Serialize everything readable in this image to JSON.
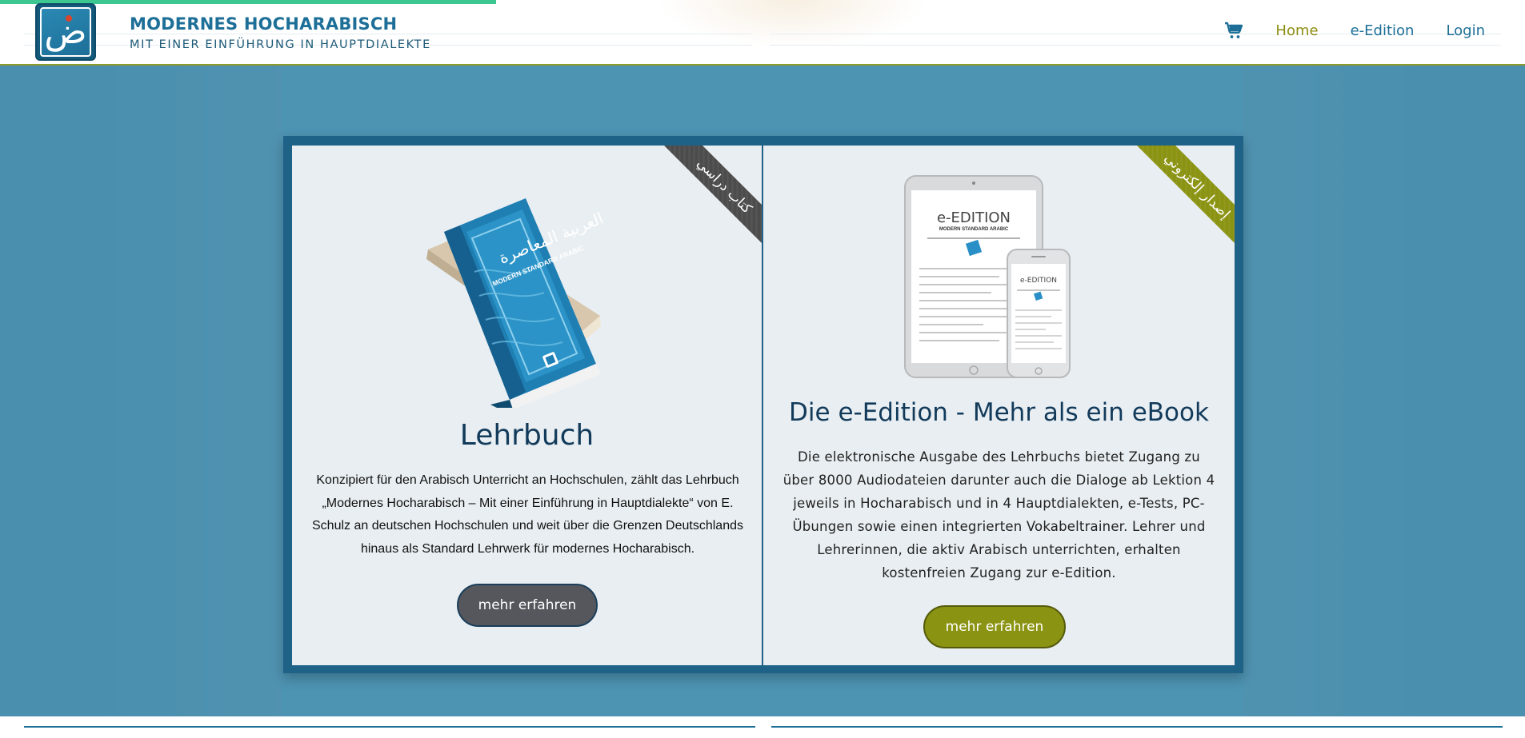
{
  "header": {
    "brand_title": "MODERNES HOCHARABISCH",
    "brand_subtitle": "MIT EINER EINFÜHRUNG IN HAUPTDIALEKTE",
    "logo_glyph": "ض",
    "cart_icon": "shopping-cart-icon"
  },
  "nav": {
    "items": [
      {
        "label": "Home",
        "active": true
      },
      {
        "label": "e-Edition",
        "active": false
      },
      {
        "label": "Login",
        "active": false
      }
    ]
  },
  "cards": [
    {
      "ribbon": "كتاب دراسي",
      "ribbon_color": "#4c4c4c",
      "title": "Lehrbuch",
      "text": "Konzipiert für den Arabisch Unterricht an Hochschulen, zählt das Lehrbuch „Modernes Hocharabisch – Mit einer Einführung in Hauptdialekte“ von E. Schulz an deutschen Hochschulen und weit über die Grenzen Deutschlands hinaus als Standard Lehrwerk für modernes Hocharabisch.",
      "button": "mehr erfahren",
      "button_color": "#55575c",
      "book": {
        "arabic_title": "العربية المعاصرة",
        "english_title": "MODERN STANDARD ARABIC"
      }
    },
    {
      "ribbon": "إصدار إلكتروني",
      "ribbon_color": "#8b9312",
      "title": "Die e-Edition - Mehr als ein eBook",
      "text": "Die elektronische Ausgabe des Lehrbuchs bietet Zugang zu über 8000 Audiodateien darunter auch die Dialoge ab Lektion 4 jeweils in Hocharabisch und in 4 Hauptdialekten, e-Tests, PC-Übungen sowie einen integrierten Vokabeltrainer. Lehrer und Lehrerinnen, die aktiv Arabisch unterrichten, erhalten kostenfreien Zugang zur e-Edition.",
      "button": "mehr erfahren",
      "button_color": "#8b9312",
      "device": {
        "tablet_title": "e-EDITION",
        "tablet_subtitle": "MODERN STANDARD ARABIC",
        "phone_title": "e-EDITION"
      }
    }
  ],
  "colors": {
    "accent_blue": "#1d6f98",
    "background_blue": "#4a8fae",
    "olive": "#8b9312",
    "progress": "#3cc690"
  }
}
